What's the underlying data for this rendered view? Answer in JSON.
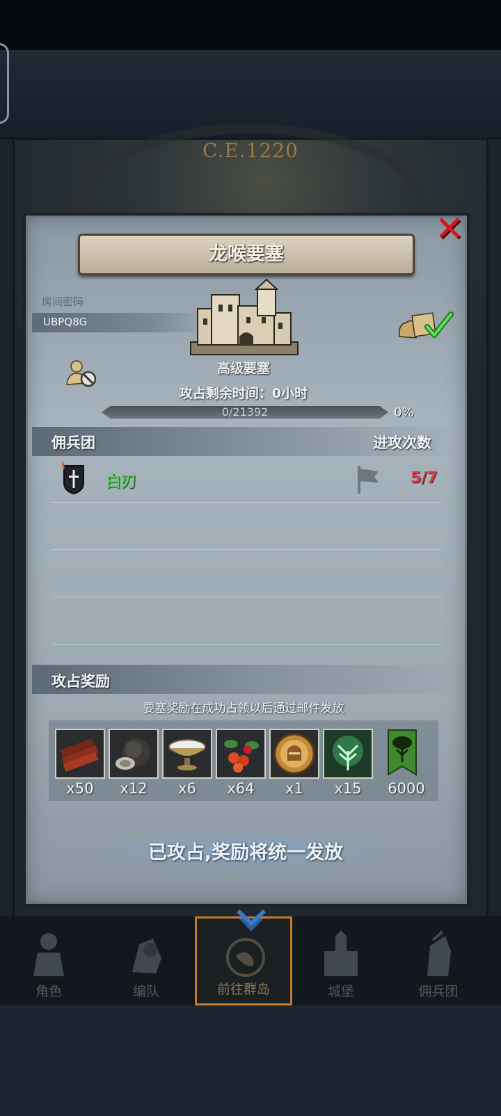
{
  "background": {
    "year_text": "C.E.1220"
  },
  "dialog": {
    "title": "龙喉要塞",
    "room_label": "房间密码",
    "room_code": "UBPQ8G",
    "fortress_level": "高级要塞",
    "time_label": "攻占剩余时间：0小时",
    "progress": {
      "text": "0/21392",
      "percent_text": "0%",
      "fraction": 0
    },
    "merc_section": {
      "title": "佣兵团",
      "right_title": "进攻次数"
    },
    "mercenaries": [
      {
        "name": "白刃",
        "attacks": "5/7"
      }
    ],
    "reward_section": {
      "title": "攻占奖励",
      "note": "要塞奖励在成功占领以后通过邮件发放",
      "items": [
        {
          "icon": "wood-planks-icon",
          "qty": "x50"
        },
        {
          "icon": "truffle-icon",
          "qty": "x12"
        },
        {
          "icon": "silver-bowl-icon",
          "qty": "x6"
        },
        {
          "icon": "berries-icon",
          "qty": "x64"
        },
        {
          "icon": "knight-coin-icon",
          "qty": "x1"
        },
        {
          "icon": "green-tree-crest-icon",
          "qty": "x15"
        },
        {
          "icon": "tree-banner-icon",
          "qty": "6000"
        }
      ]
    },
    "status_text": "已攻占,奖励将统一发放"
  },
  "nav": {
    "items": [
      {
        "label": "角色",
        "icon": "character-icon"
      },
      {
        "label": "编队",
        "icon": "formation-icon"
      },
      {
        "label": "前往群岛",
        "icon": "archipelago-icon"
      },
      {
        "label": "城堡",
        "icon": "castle-icon"
      },
      {
        "label": "佣兵团",
        "icon": "mercenary-icon"
      }
    ],
    "active": "前往群岛"
  },
  "colors": {
    "merc_name": "#5cd05c",
    "attack_count": "#d7404a",
    "close": "#d8151b",
    "nav_active_border": "#c57a28"
  }
}
